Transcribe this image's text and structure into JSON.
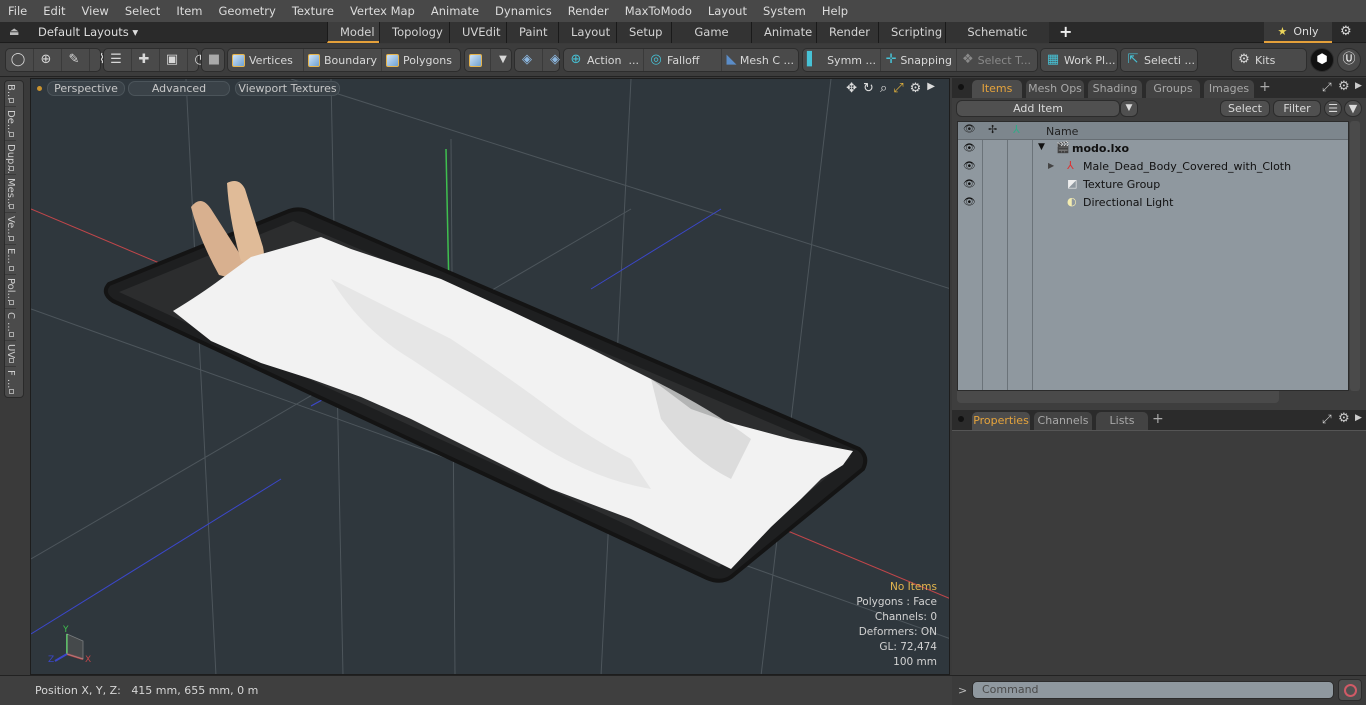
{
  "menu": [
    "File",
    "Edit",
    "View",
    "Select",
    "Item",
    "Geometry",
    "Texture",
    "Vertex Map",
    "Animate",
    "Dynamics",
    "Render",
    "MaxToModo",
    "Layout",
    "System",
    "Help"
  ],
  "layout_bar": {
    "layouts_label": "Default Layouts",
    "tabs": [
      "Model",
      "Topology",
      "UVEdit",
      "Paint",
      "Layout",
      "Setup",
      "Game Tools",
      "Animate",
      "Render",
      "Scripting",
      "Schematic Fusion"
    ],
    "active_tab": "Model",
    "add_tab": "+",
    "only_label": "Only"
  },
  "toolbar": {
    "selection_modes": [
      "Vertices",
      "Boundary",
      "Polygons"
    ],
    "action": "Action",
    "falloff": "Falloff",
    "mesh_constraints": "Mesh C ...",
    "symmetry": "Symm ...",
    "snapping": "Snapping",
    "select_through": "Select T...",
    "work_plane": "Work Pl...",
    "selection_sets": "Selecti ...",
    "kits": "Kits",
    "ellipsis": "..."
  },
  "viewport": {
    "view_mode": "Perspective",
    "shading": "Advanced",
    "textures": "Viewport Textures",
    "hud": {
      "selection": "No Items",
      "polygons": "Polygons : Face",
      "channels": "Channels: 0",
      "deformers": "Deformers: ON",
      "gl": "GL: 72,474",
      "unit": "100 mm"
    },
    "axis_labels": {
      "x": "X",
      "y": "Y",
      "z": "Z"
    },
    "colors": {
      "background": "#2f373d",
      "x_axis": "#c0464a",
      "y_axis": "#3fbf4f",
      "z_axis": "#3b47c9"
    }
  },
  "left_tabs": [
    "B...",
    "De...",
    "Dup...",
    "Mes...",
    "Ve...",
    "E...",
    "Pol...",
    "C ...",
    "UV",
    "F ..."
  ],
  "status": {
    "position_label": "Position X, Y, Z:",
    "position_value": "415 mm, 655 mm, 0 m"
  },
  "items_panel": {
    "tabs": [
      "Items",
      "Mesh Ops",
      "Shading",
      "Groups",
      "Images"
    ],
    "active_tab": "Items",
    "add_item": "Add Item",
    "select": "Select",
    "filter": "Filter",
    "column_name": "Name",
    "tree": [
      {
        "name": "modo.lxo",
        "icon": "scene-icon",
        "level": 0,
        "expanded": true,
        "bold": true
      },
      {
        "name": "Male_Dead_Body_Covered_with_Cloth",
        "icon": "mesh-locator-icon",
        "level": 1,
        "expandable": true
      },
      {
        "name": "Texture Group",
        "icon": "texture-group-icon",
        "level": 1
      },
      {
        "name": "Directional Light",
        "icon": "light-icon",
        "level": 1
      }
    ]
  },
  "properties_panel": {
    "tabs": [
      "Properties",
      "Channels",
      "Lists"
    ],
    "active_tab": "Properties"
  },
  "command": {
    "prompt": ">",
    "placeholder": "Command"
  },
  "colors": {
    "accent": "#e4a03a",
    "tree_bg": "#8f989f"
  }
}
